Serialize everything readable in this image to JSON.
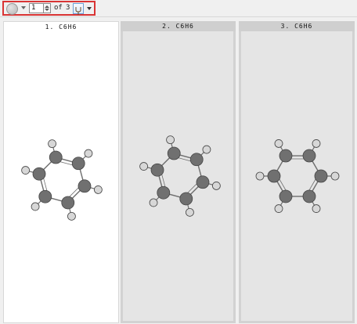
{
  "toolbar": {
    "frame_value": "1",
    "of_label": "of",
    "total": "3",
    "icons": [
      "circle-button-icon",
      "dropdown-arrow-icon",
      "spinner-icon",
      "tuning-fork-icon",
      "dropdown-arrow-icon"
    ]
  },
  "panels": [
    {
      "label": "1.  C6H6",
      "selected": true
    },
    {
      "label": "2.  C6H6",
      "selected": false
    },
    {
      "label": "3.  C6H6",
      "selected": false
    }
  ],
  "colors": {
    "highlight_border": "#d93434",
    "selected_panel": "#ffffff",
    "inactive_panel": "#e5e5e5",
    "carbon": "#707070",
    "hydrogen": "#d7d7d7"
  }
}
